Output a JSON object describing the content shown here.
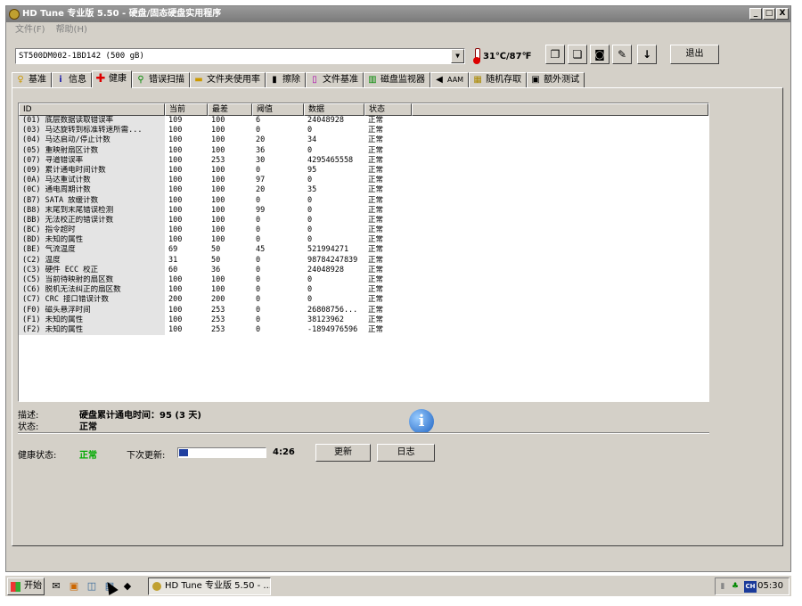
{
  "window": {
    "title": "HD Tune 专业版 5.50 - 硬盘/固态硬盘实用程序",
    "controls": [
      "_",
      "□",
      "X"
    ]
  },
  "menu": [
    "文件(F)",
    "帮助(H)"
  ],
  "toolbar": {
    "drive": "ST500DM002-1BD142 (500 gB)",
    "temperature": "31℃/87℉",
    "exit_label": "退出"
  },
  "tabs": [
    {
      "label": "基准",
      "icon": "lightbulb-icon"
    },
    {
      "label": "信息",
      "icon": "info-icon"
    },
    {
      "label": "健康",
      "icon": "health-cross-icon"
    },
    {
      "label": "错误扫描",
      "icon": "magnifier-icon"
    },
    {
      "label": "文件夹使用率",
      "icon": "folder-icon"
    },
    {
      "label": "擦除",
      "icon": "trash-icon"
    },
    {
      "label": "文件基准",
      "icon": "file-icon"
    },
    {
      "label": "磁盘监视器",
      "icon": "chart-icon"
    },
    {
      "label": "AAM",
      "icon": "speaker-icon"
    },
    {
      "label": "随机存取",
      "icon": "random-icon"
    },
    {
      "label": "额外测试",
      "icon": "extra-icon"
    }
  ],
  "table": {
    "headers": [
      "ID",
      "当前",
      "最差",
      "阈值",
      "数据",
      "状态"
    ],
    "rows": [
      [
        "(01) 底层数据读取错误率",
        "109",
        "100",
        "6",
        "24048928",
        "正常"
      ],
      [
        "(03) 马达旋转到标准转速所需...",
        "100",
        "100",
        "0",
        "0",
        "正常"
      ],
      [
        "(04) 马达启动/停止计数",
        "100",
        "100",
        "20",
        "34",
        "正常"
      ],
      [
        "(05) 重映射扇区计数",
        "100",
        "100",
        "36",
        "0",
        "正常"
      ],
      [
        "(07) 寻道错误率",
        "100",
        "253",
        "30",
        "4295465558",
        "正常"
      ],
      [
        "(09) 累计通电时间计数",
        "100",
        "100",
        "0",
        "95",
        "正常"
      ],
      [
        "(0A) 马达重试计数",
        "100",
        "100",
        "97",
        "0",
        "正常"
      ],
      [
        "(0C) 通电周期计数",
        "100",
        "100",
        "20",
        "35",
        "正常"
      ],
      [
        "(B7) SATA 放缓计数",
        "100",
        "100",
        "0",
        "0",
        "正常"
      ],
      [
        "(B8) 末尾到末尾错误检测",
        "100",
        "100",
        "99",
        "0",
        "正常"
      ],
      [
        "(BB) 无法校正的错误计数",
        "100",
        "100",
        "0",
        "0",
        "正常"
      ],
      [
        "(BC) 指令超时",
        "100",
        "100",
        "0",
        "0",
        "正常"
      ],
      [
        "(BD) 未知的属性",
        "100",
        "100",
        "0",
        "0",
        "正常"
      ],
      [
        "(BE) 气流温度",
        "69",
        "50",
        "45",
        "521994271",
        "正常"
      ],
      [
        "(C2) 温度",
        "31",
        "50",
        "0",
        "98784247839",
        "正常"
      ],
      [
        "(C3) 硬件 ECC 校正",
        "60",
        "36",
        "0",
        "24048928",
        "正常"
      ],
      [
        "(C5) 当前待映射的扇区数",
        "100",
        "100",
        "0",
        "0",
        "正常"
      ],
      [
        "(C6) 脱机无法纠正的扇区数",
        "100",
        "100",
        "0",
        "0",
        "正常"
      ],
      [
        "(C7) CRC 接口错误计数",
        "200",
        "200",
        "0",
        "0",
        "正常"
      ],
      [
        "(F0) 磁头悬浮时间",
        "100",
        "253",
        "0",
        "26808756...",
        "正常"
      ],
      [
        "(F1) 未知的属性",
        "100",
        "253",
        "0",
        "38123962",
        "正常"
      ],
      [
        "(F2) 未知的属性",
        "100",
        "253",
        "0",
        "-1894976596",
        "正常"
      ]
    ]
  },
  "details": {
    "desc_label": "描述:",
    "desc_value": "硬盘累计通电时间：95 (3 天)",
    "status_label": "状态:",
    "status_value": "正常"
  },
  "health": {
    "label": "健康状态:",
    "value": "正常",
    "next_update_label": "下次更新:",
    "progress": 0.1,
    "countdown": "4:26",
    "refresh_label": "更新",
    "log_label": "日志"
  },
  "taskbar": {
    "start_label": "开始",
    "task_label": "HD Tune 专业版 5.50 - ...",
    "tray_lang": "CH",
    "clock": "05:30"
  },
  "colors": {
    "health_ok": "#00aa00",
    "progress": "#2040a0"
  }
}
